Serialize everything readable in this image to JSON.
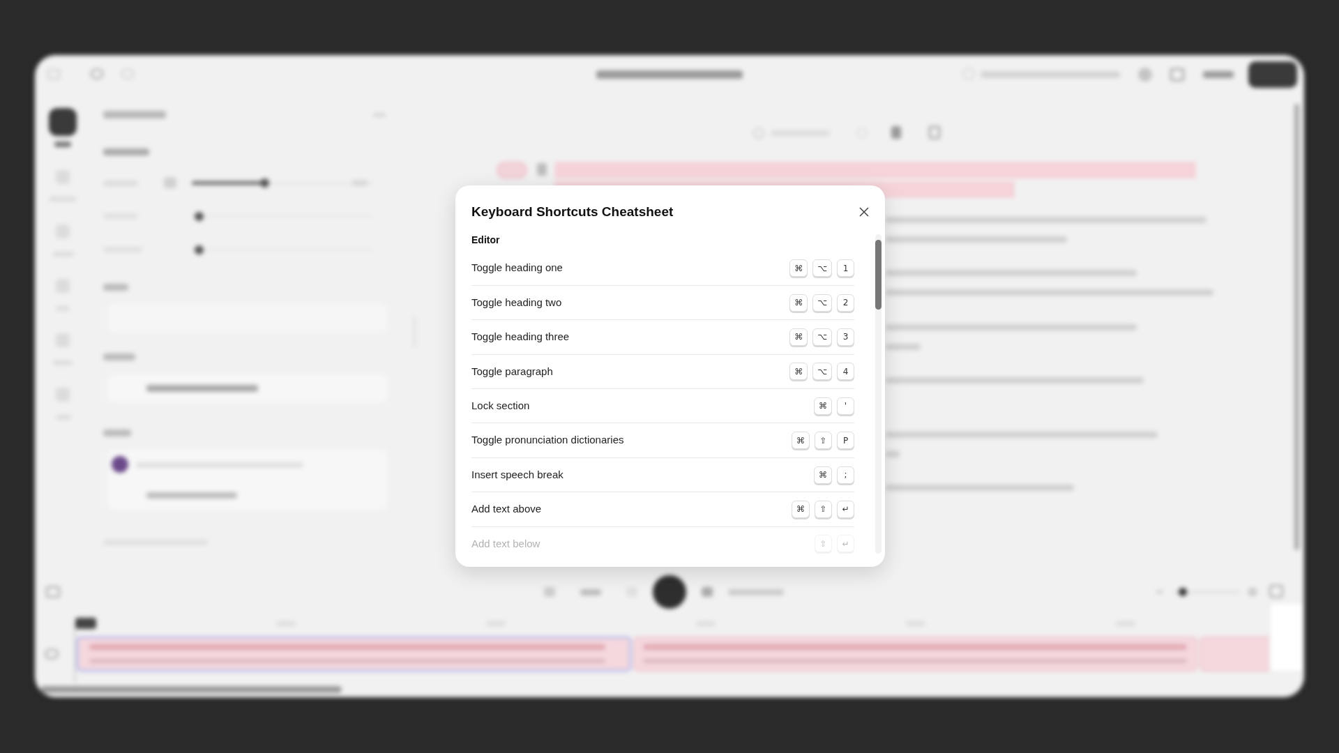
{
  "dialog": {
    "title": "Keyboard Shortcuts Cheatsheet",
    "section": "Editor",
    "rows": [
      {
        "label": "Toggle heading one",
        "keys": [
          "⌘",
          "⌥",
          "1"
        ],
        "faded": false
      },
      {
        "label": "Toggle heading two",
        "keys": [
          "⌘",
          "⌥",
          "2"
        ],
        "faded": false
      },
      {
        "label": "Toggle heading three",
        "keys": [
          "⌘",
          "⌥",
          "3"
        ],
        "faded": false
      },
      {
        "label": "Toggle paragraph",
        "keys": [
          "⌘",
          "⌥",
          "4"
        ],
        "faded": false
      },
      {
        "label": "Lock section",
        "keys": [
          "⌘",
          "'"
        ],
        "faded": false
      },
      {
        "label": "Toggle pronunciation dictionaries",
        "keys": [
          "⌘",
          "⇧",
          "P"
        ],
        "faded": false
      },
      {
        "label": "Insert speech break",
        "keys": [
          "⌘",
          ";"
        ],
        "faded": false
      },
      {
        "label": "Add text above",
        "keys": [
          "⌘",
          "⇧",
          "↵"
        ],
        "faded": false
      },
      {
        "label": "Add text below",
        "keys": [
          "⇧",
          "↵"
        ],
        "faded": true
      }
    ]
  }
}
